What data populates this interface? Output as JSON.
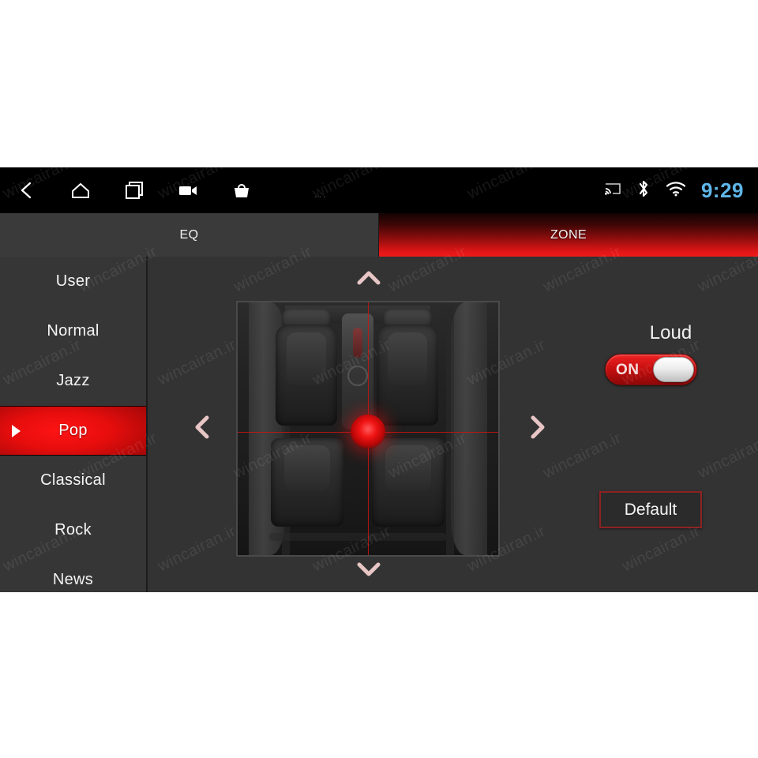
{
  "statusbar": {
    "nav_icons": [
      {
        "name": "back-icon",
        "label": "Back"
      },
      {
        "name": "home-icon",
        "label": "Home"
      },
      {
        "name": "recents-icon",
        "label": "Recent apps"
      },
      {
        "name": "video-camera-icon",
        "label": "Screen record"
      },
      {
        "name": "shopping-bag-icon",
        "label": "Apps"
      }
    ],
    "overflow": "...",
    "system_icons": [
      {
        "name": "cast-icon",
        "label": "Cast"
      },
      {
        "name": "bluetooth-icon",
        "label": "Bluetooth"
      },
      {
        "name": "wifi-icon",
        "label": "Wi-Fi"
      }
    ],
    "clock": "9:29",
    "clock_color": "#5fb6e8"
  },
  "tabs": [
    {
      "label": "EQ",
      "active": false
    },
    {
      "label": "ZONE",
      "active": true
    }
  ],
  "sidebar": {
    "presets": [
      {
        "label": "User",
        "selected": false
      },
      {
        "label": "Normal",
        "selected": false
      },
      {
        "label": "Jazz",
        "selected": false
      },
      {
        "label": "Pop",
        "selected": true
      },
      {
        "label": "Classical",
        "selected": false
      },
      {
        "label": "Rock",
        "selected": false
      },
      {
        "label": "News",
        "selected": false
      }
    ]
  },
  "stage": {
    "arrows": [
      {
        "name": "chevron-up-icon",
        "direction": "up"
      },
      {
        "name": "chevron-down-icon",
        "direction": "down"
      },
      {
        "name": "chevron-left-icon",
        "direction": "left"
      },
      {
        "name": "chevron-right-icon",
        "direction": "right"
      }
    ],
    "car_panel": {
      "name": "car-cabin-balance-map",
      "marker_name": "sound-position-marker"
    }
  },
  "controls": {
    "loud_label": "Loud",
    "loud_state": "ON",
    "default_label": "Default"
  },
  "colors": {
    "accent_red": "#e01616",
    "background": "#333333",
    "panel": "#363636",
    "clock_blue": "#5fb6e8"
  },
  "watermark": {
    "text": "wincairan.ir"
  }
}
